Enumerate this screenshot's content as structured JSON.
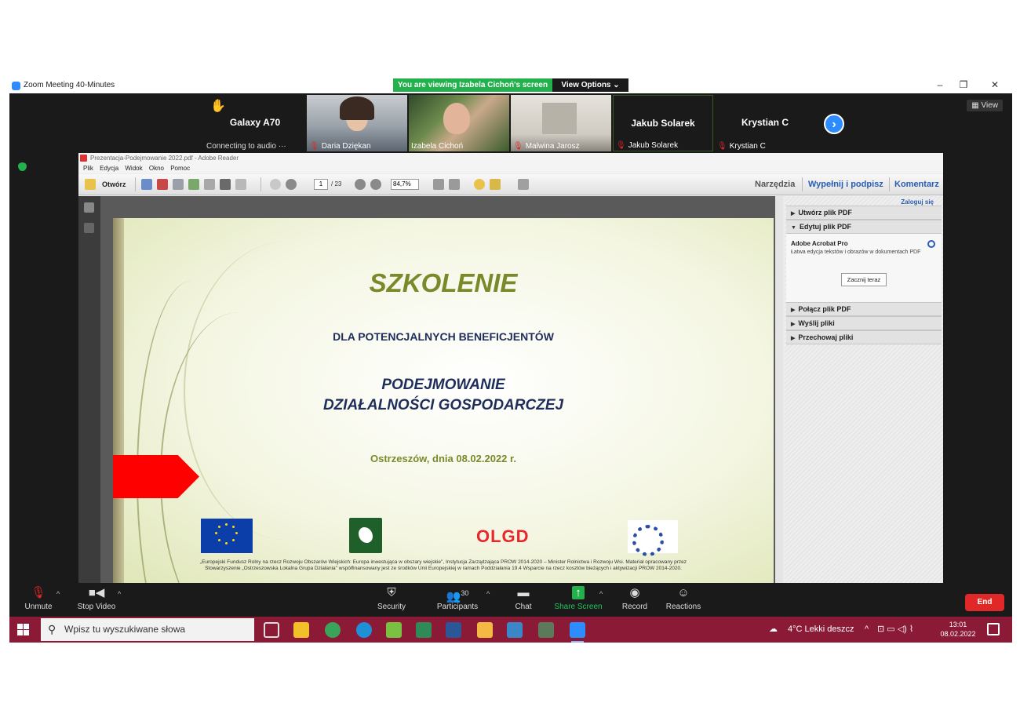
{
  "zoom": {
    "window_title": "Zoom Meeting 40-Minutes",
    "viewing_banner": "You are viewing Izabela Cichoń's screen",
    "view_options": "View Options",
    "view_button": "View",
    "window_controls": [
      "–",
      "❐",
      "✕"
    ],
    "participants": [
      {
        "name": "Galaxy A70",
        "status": "Connecting to audio ···"
      },
      {
        "name": "Daria Dziękan"
      },
      {
        "name": "Izabela Cichoń"
      },
      {
        "name": "Malwina Jarosz"
      },
      {
        "name": "Jakub Solarek",
        "label": "Jakub Solarek"
      },
      {
        "name": "Krystian C",
        "label": "Krystian C"
      }
    ],
    "controls": {
      "unmute": "Unmute",
      "stop_video": "Stop Video",
      "security": "Security",
      "participants": "Participants",
      "participants_count": "30",
      "chat": "Chat",
      "share_screen": "Share Screen",
      "record": "Record",
      "reactions": "Reactions",
      "end": "End"
    },
    "accent_color": "#2d8cff",
    "share_color": "#22b14c",
    "end_color": "#e02828"
  },
  "reader": {
    "window_title": "Prezentacja-Podejmowanie 2022.pdf - Adobe Reader",
    "menu": [
      "Plik",
      "Edycja",
      "Widok",
      "Okno",
      "Pomoc"
    ],
    "toolbar": {
      "open": "Otwórz",
      "page_current": "1",
      "page_total": "/ 23",
      "zoom": "84,7%",
      "tools": "Narzędzia",
      "fill_sign": "Wypełnij i podpisz",
      "comment": "Komentarz"
    },
    "side_panel": {
      "login": "Zaloguj się",
      "sections": [
        {
          "label": "Utwórz plik PDF",
          "expanded": false
        },
        {
          "label": "Edytuj plik PDF",
          "expanded": true
        },
        {
          "label": "Połącz plik PDF",
          "expanded": false
        },
        {
          "label": "Wyślij pliki",
          "expanded": false
        },
        {
          "label": "Przechowaj pliki",
          "expanded": false
        }
      ],
      "promo_title": "Adobe Acrobat Pro",
      "promo_desc": "Łatwa edycja tekstów i obrazów w dokumentach PDF",
      "promo_button": "Zacznij teraz"
    }
  },
  "slide": {
    "title": "SZKOLENIE",
    "subtitle": "DLA POTENCJALNYCH BENEFICJENTÓW",
    "heading_line1": "PODEJMOWANIE",
    "heading_line2": "DZIAŁALNOŚCI GOSPODARCZEJ",
    "date": "Ostrzeszów, dnia 08.02.2022 r.",
    "olgd_logo": "OLGD",
    "footer": "„Europejski Fundusz Rolny na rzecz Rozwoju Obszarów Wiejskich: Europa inwestująca w obszary wiejskie\", Instytucja Zarządzająca PROW 2014-2020 – Minister Rolnictwa i Rozwoju Wsi. Materiał opracowany przez Stowarzyszenie „Ostrzeszowska Lokalna Grupa Działania\" współfinansowany jest ze środków Unii Europejskiej w ramach Poddziałania 19.4 Wsparcie na rzecz kosztów bieżących i aktywizacji PROW 2014-2020.",
    "accent_green": "#7a8a2a",
    "navy": "#1f2d5a"
  },
  "taskbar": {
    "search_placeholder": "Wpisz tu wyszukiwane słowa",
    "weather": "4°C  Lekki deszcz",
    "time": "13:01",
    "date": "08.02.2022",
    "color": "#8a1a35"
  }
}
